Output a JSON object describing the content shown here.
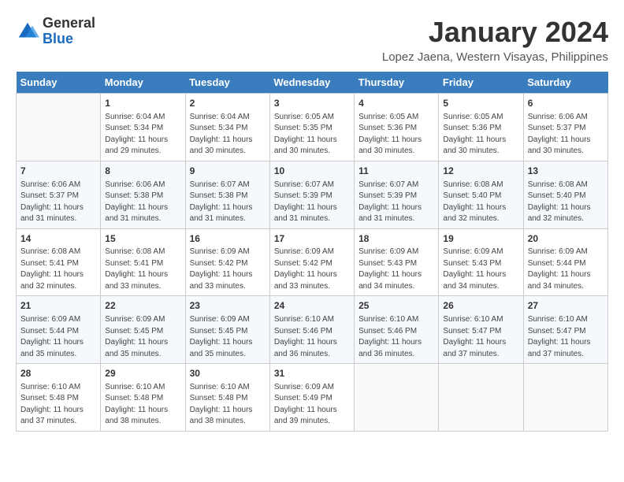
{
  "header": {
    "logo_general": "General",
    "logo_blue": "Blue",
    "month_title": "January 2024",
    "location": "Lopez Jaena, Western Visayas, Philippines"
  },
  "days_of_week": [
    "Sunday",
    "Monday",
    "Tuesday",
    "Wednesday",
    "Thursday",
    "Friday",
    "Saturday"
  ],
  "weeks": [
    [
      {
        "num": "",
        "info": ""
      },
      {
        "num": "1",
        "info": "Sunrise: 6:04 AM\nSunset: 5:34 PM\nDaylight: 11 hours\nand 29 minutes."
      },
      {
        "num": "2",
        "info": "Sunrise: 6:04 AM\nSunset: 5:34 PM\nDaylight: 11 hours\nand 30 minutes."
      },
      {
        "num": "3",
        "info": "Sunrise: 6:05 AM\nSunset: 5:35 PM\nDaylight: 11 hours\nand 30 minutes."
      },
      {
        "num": "4",
        "info": "Sunrise: 6:05 AM\nSunset: 5:36 PM\nDaylight: 11 hours\nand 30 minutes."
      },
      {
        "num": "5",
        "info": "Sunrise: 6:05 AM\nSunset: 5:36 PM\nDaylight: 11 hours\nand 30 minutes."
      },
      {
        "num": "6",
        "info": "Sunrise: 6:06 AM\nSunset: 5:37 PM\nDaylight: 11 hours\nand 30 minutes."
      }
    ],
    [
      {
        "num": "7",
        "info": "Sunrise: 6:06 AM\nSunset: 5:37 PM\nDaylight: 11 hours\nand 31 minutes."
      },
      {
        "num": "8",
        "info": "Sunrise: 6:06 AM\nSunset: 5:38 PM\nDaylight: 11 hours\nand 31 minutes."
      },
      {
        "num": "9",
        "info": "Sunrise: 6:07 AM\nSunset: 5:38 PM\nDaylight: 11 hours\nand 31 minutes."
      },
      {
        "num": "10",
        "info": "Sunrise: 6:07 AM\nSunset: 5:39 PM\nDaylight: 11 hours\nand 31 minutes."
      },
      {
        "num": "11",
        "info": "Sunrise: 6:07 AM\nSunset: 5:39 PM\nDaylight: 11 hours\nand 31 minutes."
      },
      {
        "num": "12",
        "info": "Sunrise: 6:08 AM\nSunset: 5:40 PM\nDaylight: 11 hours\nand 32 minutes."
      },
      {
        "num": "13",
        "info": "Sunrise: 6:08 AM\nSunset: 5:40 PM\nDaylight: 11 hours\nand 32 minutes."
      }
    ],
    [
      {
        "num": "14",
        "info": "Sunrise: 6:08 AM\nSunset: 5:41 PM\nDaylight: 11 hours\nand 32 minutes."
      },
      {
        "num": "15",
        "info": "Sunrise: 6:08 AM\nSunset: 5:41 PM\nDaylight: 11 hours\nand 33 minutes."
      },
      {
        "num": "16",
        "info": "Sunrise: 6:09 AM\nSunset: 5:42 PM\nDaylight: 11 hours\nand 33 minutes."
      },
      {
        "num": "17",
        "info": "Sunrise: 6:09 AM\nSunset: 5:42 PM\nDaylight: 11 hours\nand 33 minutes."
      },
      {
        "num": "18",
        "info": "Sunrise: 6:09 AM\nSunset: 5:43 PM\nDaylight: 11 hours\nand 34 minutes."
      },
      {
        "num": "19",
        "info": "Sunrise: 6:09 AM\nSunset: 5:43 PM\nDaylight: 11 hours\nand 34 minutes."
      },
      {
        "num": "20",
        "info": "Sunrise: 6:09 AM\nSunset: 5:44 PM\nDaylight: 11 hours\nand 34 minutes."
      }
    ],
    [
      {
        "num": "21",
        "info": "Sunrise: 6:09 AM\nSunset: 5:44 PM\nDaylight: 11 hours\nand 35 minutes."
      },
      {
        "num": "22",
        "info": "Sunrise: 6:09 AM\nSunset: 5:45 PM\nDaylight: 11 hours\nand 35 minutes."
      },
      {
        "num": "23",
        "info": "Sunrise: 6:09 AM\nSunset: 5:45 PM\nDaylight: 11 hours\nand 35 minutes."
      },
      {
        "num": "24",
        "info": "Sunrise: 6:10 AM\nSunset: 5:46 PM\nDaylight: 11 hours\nand 36 minutes."
      },
      {
        "num": "25",
        "info": "Sunrise: 6:10 AM\nSunset: 5:46 PM\nDaylight: 11 hours\nand 36 minutes."
      },
      {
        "num": "26",
        "info": "Sunrise: 6:10 AM\nSunset: 5:47 PM\nDaylight: 11 hours\nand 37 minutes."
      },
      {
        "num": "27",
        "info": "Sunrise: 6:10 AM\nSunset: 5:47 PM\nDaylight: 11 hours\nand 37 minutes."
      }
    ],
    [
      {
        "num": "28",
        "info": "Sunrise: 6:10 AM\nSunset: 5:48 PM\nDaylight: 11 hours\nand 37 minutes."
      },
      {
        "num": "29",
        "info": "Sunrise: 6:10 AM\nSunset: 5:48 PM\nDaylight: 11 hours\nand 38 minutes."
      },
      {
        "num": "30",
        "info": "Sunrise: 6:10 AM\nSunset: 5:48 PM\nDaylight: 11 hours\nand 38 minutes."
      },
      {
        "num": "31",
        "info": "Sunrise: 6:09 AM\nSunset: 5:49 PM\nDaylight: 11 hours\nand 39 minutes."
      },
      {
        "num": "",
        "info": ""
      },
      {
        "num": "",
        "info": ""
      },
      {
        "num": "",
        "info": ""
      }
    ]
  ]
}
